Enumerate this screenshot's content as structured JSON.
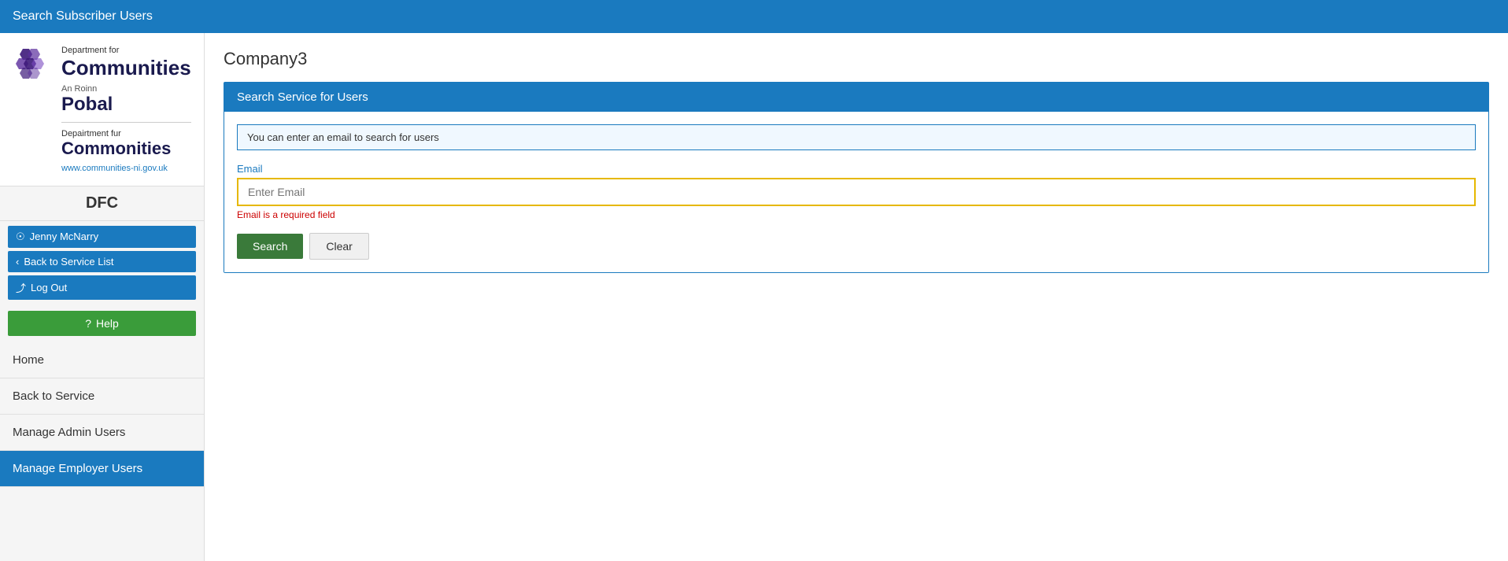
{
  "header": {
    "title": "Search Subscriber Users"
  },
  "sidebar": {
    "logo": {
      "dept_for": "Department for",
      "communities": "Communities",
      "an_roinn": "An Roinn",
      "pobal": "Pobal",
      "depairtment_fur": "Depairtment fur",
      "commonities": "Commonities",
      "url": "www.communities-ni.gov.uk"
    },
    "dfc_label": "DFC",
    "user_name": "Jenny McNarry",
    "back_to_service_list": "Back to Service List",
    "log_out": "Log Out",
    "help": "Help",
    "nav": [
      {
        "label": "Home",
        "active": false
      },
      {
        "label": "Back to Service",
        "active": false
      },
      {
        "label": "Manage Admin Users",
        "active": false
      },
      {
        "label": "Manage Employer Users",
        "active": true
      }
    ]
  },
  "main": {
    "page_title": "Company3",
    "search_card": {
      "header": "Search Service for Users",
      "hint": "You can enter an email to search for users",
      "email_label": "Email",
      "email_placeholder": "Enter Email",
      "email_error": "Email is a required field",
      "search_btn": "Search",
      "clear_btn": "Clear"
    }
  }
}
